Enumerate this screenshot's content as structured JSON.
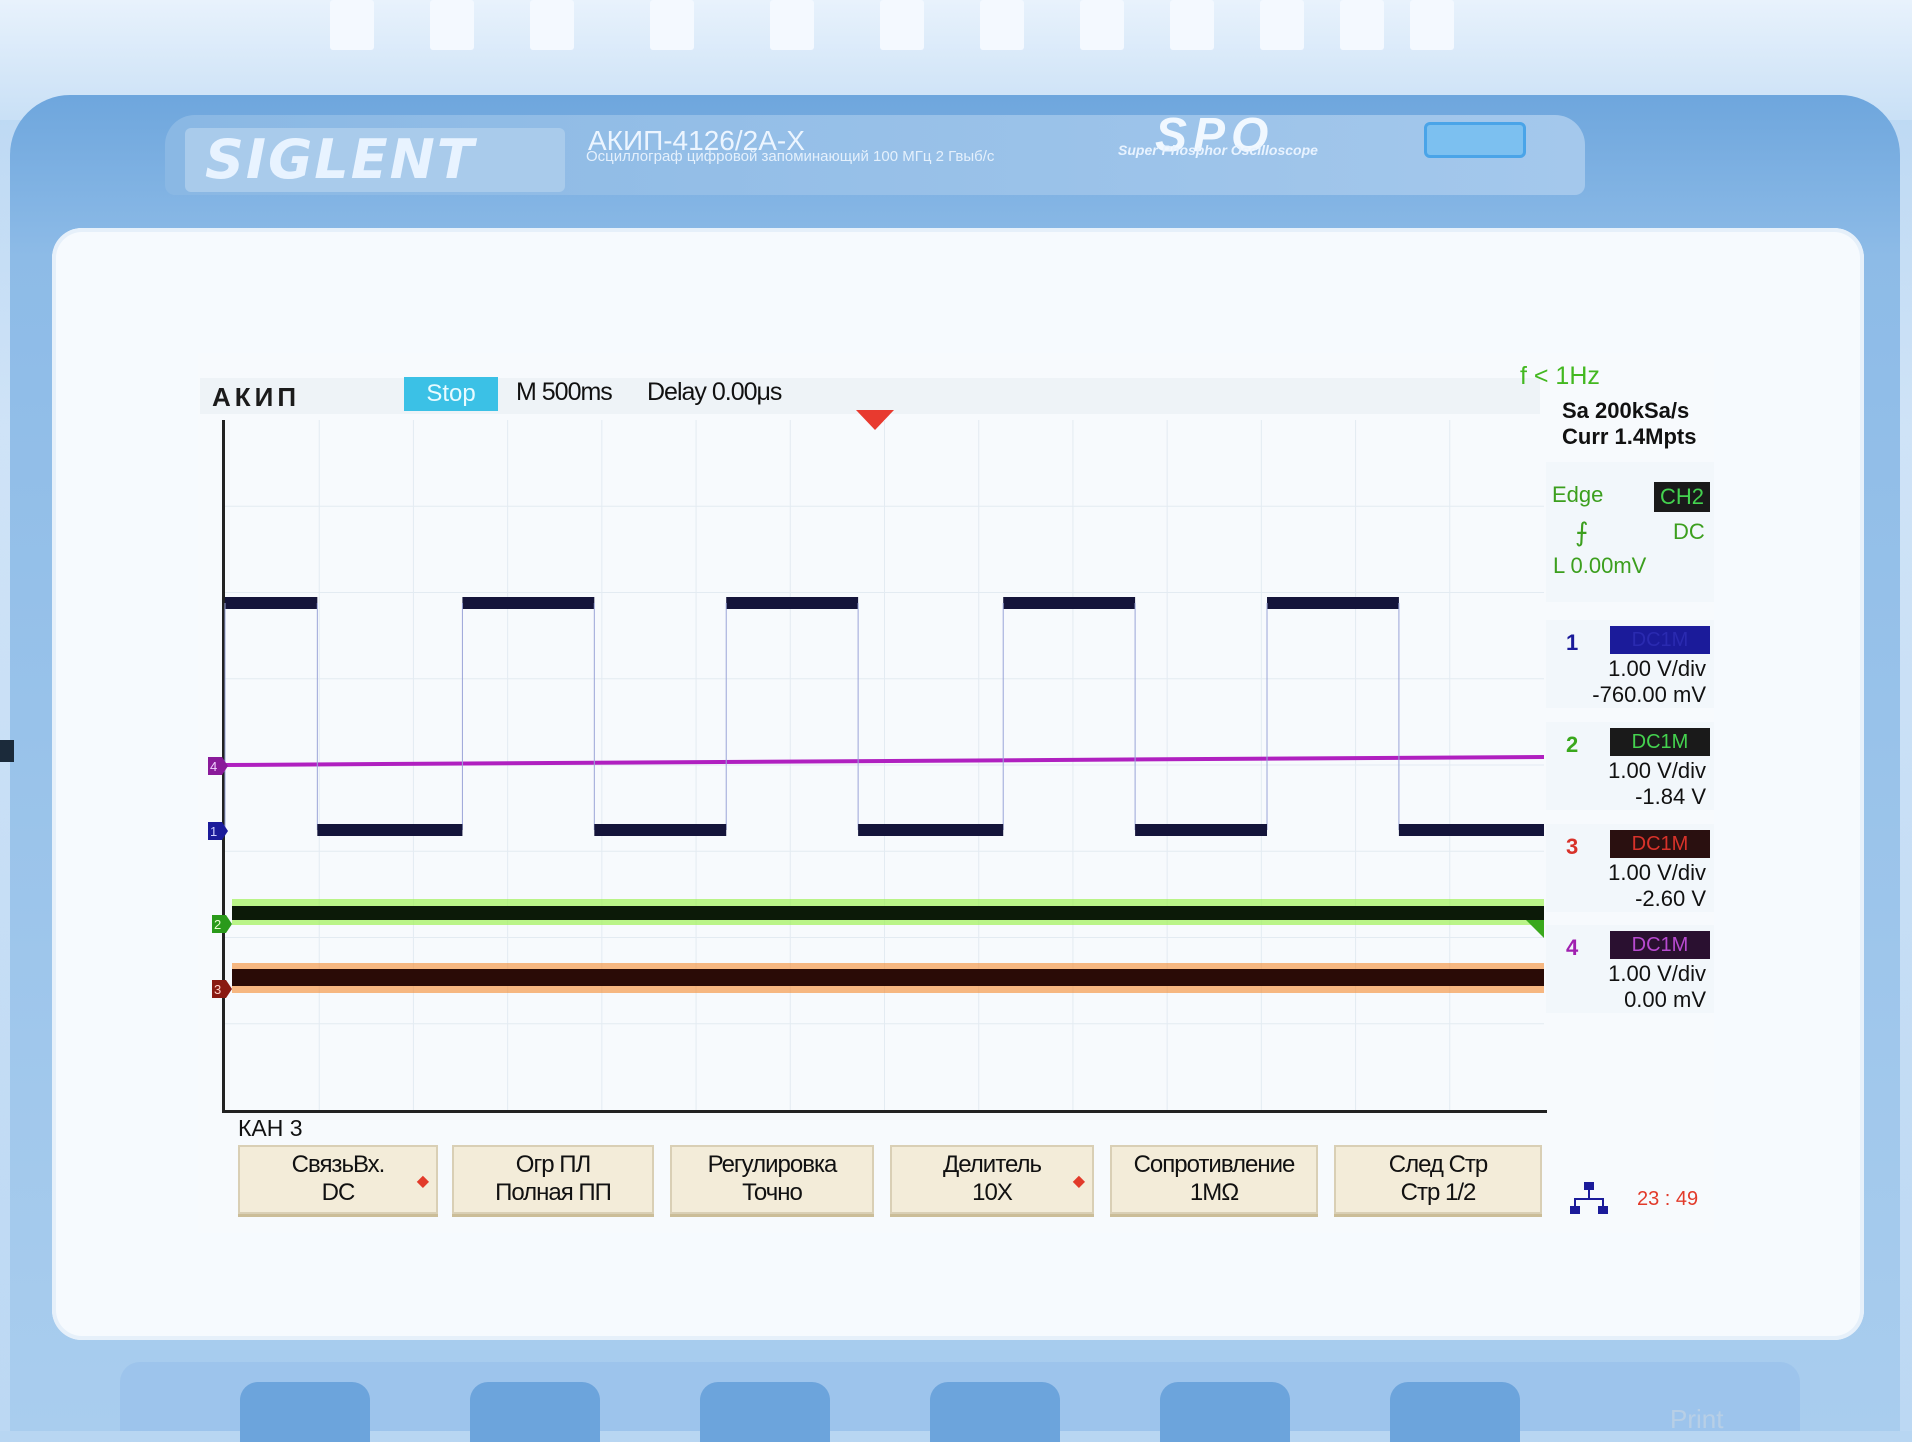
{
  "brand": {
    "logo": "SIGLENT",
    "model": "АКИП-4126/2А-Х",
    "subtitle": "Осциллограф цифровой запоминающий  100 МГц  2 Гвыб/с",
    "spo": "SPO",
    "spo_sub": "Super Phosphor Oscilloscope"
  },
  "topbar": {
    "logo": "АКИП",
    "state": "Stop",
    "timebase": "M 500ms",
    "delay": "Delay 0.00μs",
    "freq": "f < 1Hz"
  },
  "acquisition": {
    "sample_rate": "Sa 200kSa/s",
    "memory": "Curr 1.4Mpts"
  },
  "trigger": {
    "type": "Edge",
    "source": "CH2",
    "coupling": "DC",
    "level": "L  0.00mV",
    "edge_glyph": "⨍"
  },
  "channels": [
    {
      "num": "1",
      "coupling": "DC1M",
      "vdiv": "1.00 V/div",
      "offset": "-760.00 mV",
      "color": "#1b1b9a",
      "badge_bg": "#1b1b9a",
      "badge_fg": "#1b1b9a"
    },
    {
      "num": "2",
      "coupling": "DC1M",
      "vdiv": "1.00 V/div",
      "offset": "-1.84 V",
      "color": "#3aa81c",
      "badge_bg": "#1a1a1a",
      "badge_fg": "#44d24f"
    },
    {
      "num": "3",
      "coupling": "DC1M",
      "vdiv": "1.00 V/div",
      "offset": "-2.60 V",
      "color": "#d8322a",
      "badge_bg": "#2a1010",
      "badge_fg": "#d8322a"
    },
    {
      "num": "4",
      "coupling": "DC1M",
      "vdiv": "1.00 V/div",
      "offset": "0.00 mV",
      "color": "#a020b0",
      "badge_bg": "#2a1030",
      "badge_fg": "#b84ad0"
    }
  ],
  "menu": {
    "title": "КАН 3",
    "softkeys": [
      {
        "line1": "СвязьВх.",
        "line2": "DC",
        "arrow": true
      },
      {
        "line1": "Огр  ПЛ",
        "line2": "Полная ПП",
        "arrow": false
      },
      {
        "line1": "Регулировка",
        "line2": "Точно",
        "arrow": false
      },
      {
        "line1": "Делитель",
        "line2": "10X",
        "arrow": true
      },
      {
        "line1": "Сопротивление",
        "line2": "1MΩ",
        "arrow": false
      },
      {
        "line1": "След  Стр",
        "line2": "Стр 1/2",
        "arrow": false
      }
    ]
  },
  "status": {
    "clock": "23 : 49"
  },
  "bezel": {
    "print": "Print"
  },
  "ch_markers": [
    "4",
    "1",
    "2",
    "3"
  ],
  "colors": {
    "stop": "#3bc1e6",
    "trigger_marker": "#e83a2f",
    "ch1": "#1b1b9a",
    "ch2": "#6fe03a",
    "ch3": "#e83a2f",
    "ch4": "#b020c0"
  },
  "waveform": {
    "ch1_high_segments": [
      [
        0.0,
        0.07
      ],
      [
        0.18,
        0.28
      ],
      [
        0.38,
        0.48
      ],
      [
        0.59,
        0.69
      ],
      [
        0.79,
        0.89
      ]
    ],
    "ch1_low_segments": [
      [
        0.07,
        0.18
      ],
      [
        0.28,
        0.38
      ],
      [
        0.48,
        0.59
      ],
      [
        0.69,
        0.79
      ],
      [
        0.89,
        1.0
      ]
    ]
  }
}
